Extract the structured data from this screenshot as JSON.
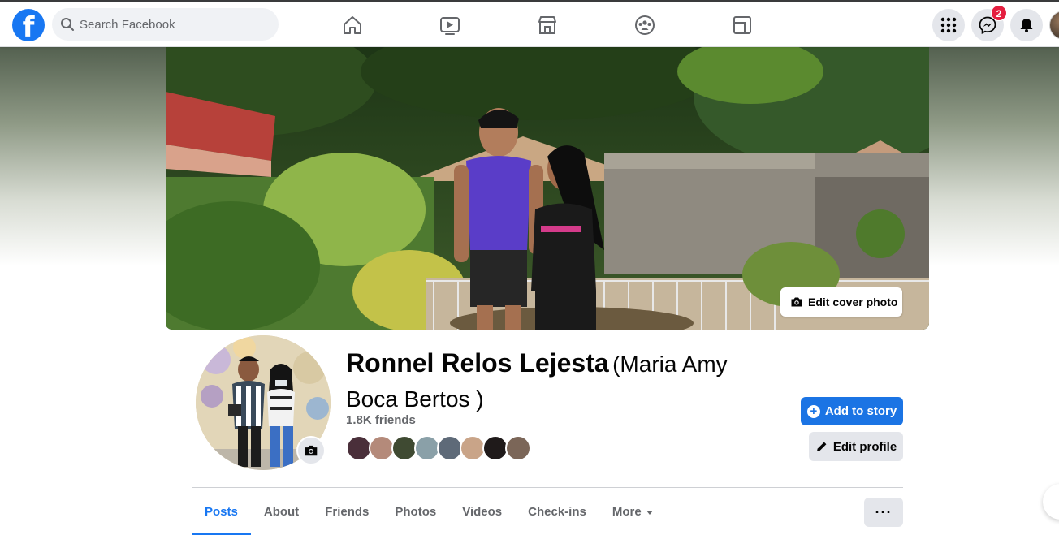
{
  "colors": {
    "brand": "#1877f2",
    "badge": "#e41e3f",
    "secondary_button": "#e4e6eb",
    "muted_text": "#65676b"
  },
  "topbar": {
    "search": {
      "placeholder": "Search Facebook",
      "value": ""
    },
    "nav_icons": [
      "home-icon",
      "watch-icon",
      "marketplace-icon",
      "groups-icon",
      "gaming-icon"
    ],
    "right_buttons": [
      "menu-grid-icon",
      "messenger-icon",
      "notifications-icon"
    ],
    "messenger_badge": "2"
  },
  "cover": {
    "edit_label": "Edit cover photo"
  },
  "profile": {
    "name": "Ronnel Relos Lejesta",
    "alternate_name": "(Maria Amy Boca Bertos )",
    "friends_count": "1.8K friends",
    "friend_avatar_count": 8,
    "add_story_label": "Add to story",
    "edit_profile_label": "Edit profile"
  },
  "tabs": [
    {
      "label": "Posts",
      "active": true
    },
    {
      "label": "About",
      "active": false
    },
    {
      "label": "Friends",
      "active": false
    },
    {
      "label": "Photos",
      "active": false
    },
    {
      "label": "Videos",
      "active": false
    },
    {
      "label": "Check-ins",
      "active": false
    },
    {
      "label": "More",
      "active": false
    }
  ],
  "more_actions_label": "···"
}
